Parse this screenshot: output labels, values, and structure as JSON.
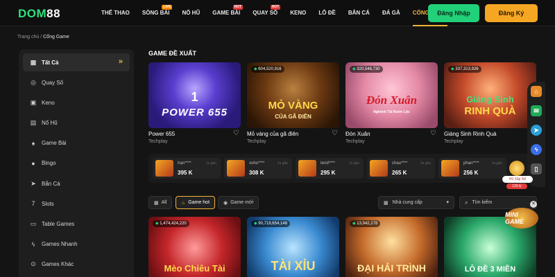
{
  "header": {
    "logo_part1": "DOM",
    "logo_part2": "88",
    "nav": [
      {
        "label": "THỂ THAO",
        "badge": ""
      },
      {
        "label": "SÒNG BÀI",
        "badge": "LIVE"
      },
      {
        "label": "NỔ HŨ",
        "badge": ""
      },
      {
        "label": "GAME BÀI",
        "badge": "HOT"
      },
      {
        "label": "QUAY SỐ",
        "badge": "HOT"
      },
      {
        "label": "KENO",
        "badge": ""
      },
      {
        "label": "LÔ ĐỀ",
        "badge": ""
      },
      {
        "label": "BẮN CÁ",
        "badge": ""
      },
      {
        "label": "ĐÁ GÀ",
        "badge": ""
      },
      {
        "label": "CỔNG GAME",
        "badge": ""
      }
    ],
    "login_label": "Đăng Nhập",
    "register_label": "Đăng Ký"
  },
  "breadcrumb": {
    "home": "Trang chủ",
    "separator": "/",
    "current": "Cổng Game"
  },
  "sidebar": {
    "items": [
      {
        "label": "Tất Cả",
        "icon": "grid-icon"
      },
      {
        "label": "Quay Số",
        "icon": "lottery-ball-icon"
      },
      {
        "label": "Keno",
        "icon": "keno-icon"
      },
      {
        "label": "Nổ Hũ",
        "icon": "slot-machine-icon"
      },
      {
        "label": "Game Bài",
        "icon": "cards-icon"
      },
      {
        "label": "Bingo",
        "icon": "bingo-icon"
      },
      {
        "label": "Bắn Cá",
        "icon": "fish-icon"
      },
      {
        "label": "Slots",
        "icon": "seven-icon"
      },
      {
        "label": "Table Games",
        "icon": "table-icon"
      },
      {
        "label": "Games Nhanh",
        "icon": "lightning-icon"
      },
      {
        "label": "Games Khác",
        "icon": "more-icon"
      }
    ]
  },
  "featured": {
    "title": "GAME ĐỀ XUẤT",
    "games": [
      {
        "name": "Power 655",
        "provider": "Techplay",
        "jackpot": "",
        "art": "POWER 655",
        "art2": "1"
      },
      {
        "name": "Mỏ vàng của gã điên",
        "provider": "Techplay",
        "jackpot": "604,520,916",
        "art": "MỎ VÀNG",
        "art2": "CỦA GÃ ĐIÊN"
      },
      {
        "name": "Đón Xuân",
        "provider": "Techplay",
        "jackpot": "320,546,730",
        "art": "Đón Xuân",
        "art2": "Nghênh Tài Rước Lộc"
      },
      {
        "name": "Giáng Sinh Rinh Quà",
        "provider": "Techplay",
        "jackpot": "337,313,926",
        "art": "Giáng Sinh",
        "art2": "RINH QUÀ"
      }
    ]
  },
  "winners": [
    {
      "user": "tran****",
      "amount": "395 K",
      "ago": "1s gần"
    },
    {
      "user": "vuho****",
      "amount": "308 K",
      "ago": "1s gần"
    },
    {
      "user": "tend****",
      "amount": "295 K",
      "ago": "1s gần"
    },
    {
      "user": "chau****",
      "amount": "265 K",
      "ago": "1s gần"
    },
    {
      "user": "phan****",
      "amount": "256 K",
      "ago": "1s gần"
    }
  ],
  "filters": {
    "all": "All",
    "hot": "Game hot",
    "new": "Game mới",
    "provider_placeholder": "Nhà cung cấp",
    "search_placeholder": "Tìm kiếm"
  },
  "games": [
    {
      "jackpot": "1,474,424,220",
      "art": "Mèo Chiêu Tài"
    },
    {
      "jackpot": "90,719,654,148",
      "art": "TÀI XỈU"
    },
    {
      "jackpot": "13,942,278",
      "art": "ĐẠI HẢI TRÌNH"
    },
    {
      "jackpot": "",
      "art": "LÔ ĐỀ 3 MIỀN"
    }
  ],
  "floating": {
    "hu_sap_no": "Hũ Sắp Nổ",
    "hu_sap_no_sub": "133 tỷ",
    "mini_game": "MINI GAME"
  }
}
